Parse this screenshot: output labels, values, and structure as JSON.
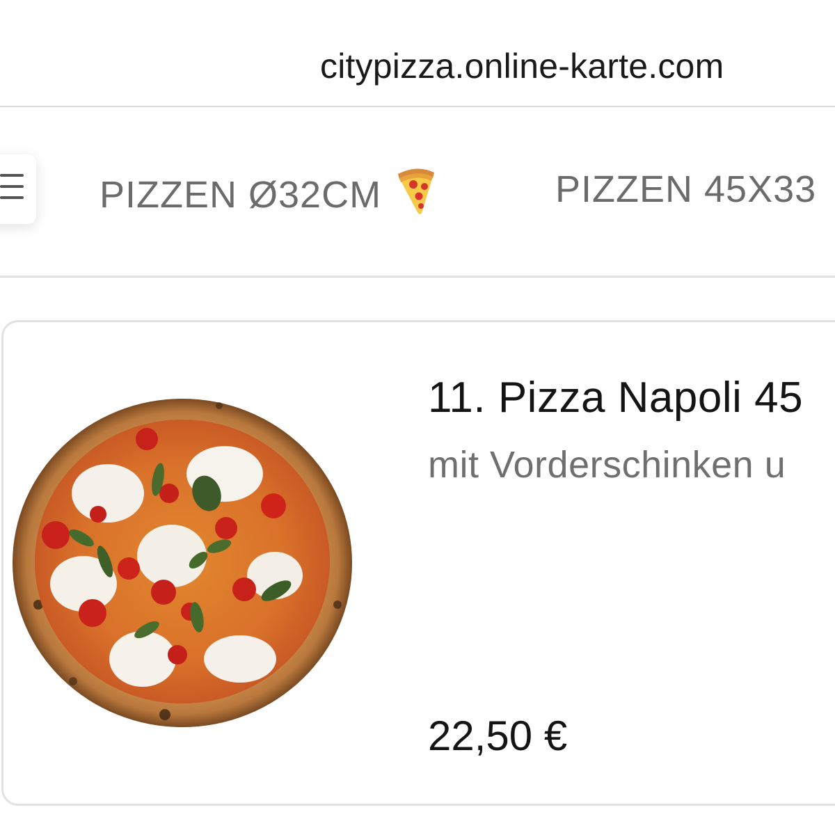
{
  "browser": {
    "url": "citypizza.online-karte.com"
  },
  "nav": {
    "menu_icon": "hamburger-menu-icon",
    "tabs": [
      {
        "label": "PIZZEN Ø32CM",
        "icon": "pizza-slice-icon"
      },
      {
        "label": "PIZZEN 45X33"
      }
    ]
  },
  "product": {
    "title": "11. Pizza Napoli 45",
    "description": "mit Vorderschinken u",
    "price": "22,50 €",
    "image": "pizza-margherita-photo"
  },
  "colors": {
    "tab_text": "#6b6b6b",
    "title_text": "#141414",
    "desc_text": "#6f6f6f",
    "card_border": "#e2e2e2"
  }
}
